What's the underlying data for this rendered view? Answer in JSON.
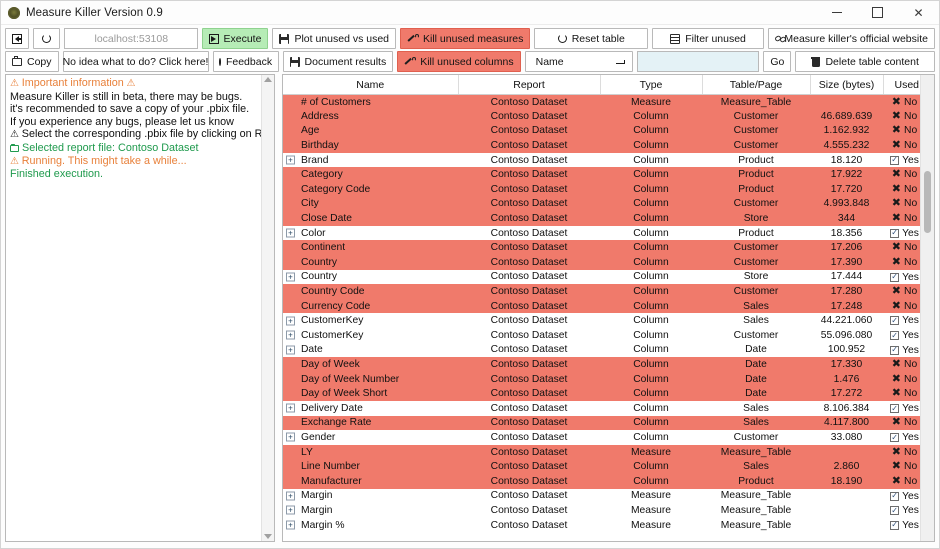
{
  "window": {
    "title": "Measure Killer Version 0.9",
    "app_icon": "app-logo-icon",
    "minimize": "–",
    "maximize": "□",
    "close": "✕"
  },
  "toolbar": {
    "row1": {
      "back_label": "",
      "refresh_label": "",
      "url_value": "localhost:53108",
      "execute_label": "Execute",
      "plot_label": "Plot unused vs used",
      "kill_measures_label": "Kill unused measures",
      "reset_table_label": "Reset table",
      "filter_unused_label": "Filter unused",
      "website_label": "Measure killer's official website"
    },
    "row2": {
      "copy_label": "Copy",
      "help_label": "No idea what to do? Click here!",
      "feedback_label": "Feedback",
      "document_label": "Document results",
      "kill_columns_label": "Kill unused columns",
      "name_dropdown_value": "Name",
      "search_value": "",
      "search_placeholder": "",
      "go_label": "Go",
      "delete_table_label": "Delete table content"
    }
  },
  "log_panel": {
    "lines": [
      {
        "text": "Important information",
        "color": "orange",
        "icon": "warning-icon",
        "icon_after": "warning-icon"
      },
      {
        "text": "Measure Killer is still in beta, there may be bugs.",
        "color": "black",
        "icon": ""
      },
      {
        "text": "it's recommended to save a copy of your .pbix file.",
        "color": "black",
        "icon": ""
      },
      {
        "text": "If you experience any bugs, please let us know",
        "color": "black",
        "icon": ""
      },
      {
        "text": "Select the corresponding .pbix file by clicking on Run",
        "color": "black",
        "icon": "warning-icon"
      },
      {
        "text": "Selected report file: Contoso Dataset",
        "color": "green",
        "icon": "folder-icon"
      },
      {
        "text": "Running. This might take a while...",
        "color": "orange",
        "icon": "warning-icon"
      },
      {
        "text": "Finished execution.",
        "color": "green",
        "icon": ""
      }
    ]
  },
  "table": {
    "columns": [
      "Name",
      "Report",
      "Type",
      "Table/Page",
      "Size (bytes)",
      "Used"
    ],
    "yes_label": "Yes",
    "no_label": "No",
    "rows": [
      {
        "name": "# of Customers",
        "report": "Contoso Dataset",
        "type": "Measure",
        "table": "Measure_Table",
        "size": "",
        "used": "No",
        "expandable": false
      },
      {
        "name": "Address",
        "report": "Contoso Dataset",
        "type": "Column",
        "table": "Customer",
        "size": "46.689.639",
        "used": "No",
        "expandable": false
      },
      {
        "name": "Age",
        "report": "Contoso Dataset",
        "type": "Column",
        "table": "Customer",
        "size": "1.162.932",
        "used": "No",
        "expandable": false
      },
      {
        "name": "Birthday",
        "report": "Contoso Dataset",
        "type": "Column",
        "table": "Customer",
        "size": "4.555.232",
        "used": "No",
        "expandable": false
      },
      {
        "name": "Brand",
        "report": "Contoso Dataset",
        "type": "Column",
        "table": "Product",
        "size": "18.120",
        "used": "Yes",
        "expandable": true
      },
      {
        "name": "Category",
        "report": "Contoso Dataset",
        "type": "Column",
        "table": "Product",
        "size": "17.922",
        "used": "No",
        "expandable": false
      },
      {
        "name": "Category Code",
        "report": "Contoso Dataset",
        "type": "Column",
        "table": "Product",
        "size": "17.720",
        "used": "No",
        "expandable": false
      },
      {
        "name": "City",
        "report": "Contoso Dataset",
        "type": "Column",
        "table": "Customer",
        "size": "4.993.848",
        "used": "No",
        "expandable": false
      },
      {
        "name": "Close Date",
        "report": "Contoso Dataset",
        "type": "Column",
        "table": "Store",
        "size": "344",
        "used": "No",
        "expandable": false
      },
      {
        "name": "Color",
        "report": "Contoso Dataset",
        "type": "Column",
        "table": "Product",
        "size": "18.356",
        "used": "Yes",
        "expandable": true
      },
      {
        "name": "Continent",
        "report": "Contoso Dataset",
        "type": "Column",
        "table": "Customer",
        "size": "17.206",
        "used": "No",
        "expandable": false
      },
      {
        "name": "Country",
        "report": "Contoso Dataset",
        "type": "Column",
        "table": "Customer",
        "size": "17.390",
        "used": "No",
        "expandable": false
      },
      {
        "name": "Country",
        "report": "Contoso Dataset",
        "type": "Column",
        "table": "Store",
        "size": "17.444",
        "used": "Yes",
        "expandable": true
      },
      {
        "name": "Country Code",
        "report": "Contoso Dataset",
        "type": "Column",
        "table": "Customer",
        "size": "17.280",
        "used": "No",
        "expandable": false
      },
      {
        "name": "Currency Code",
        "report": "Contoso Dataset",
        "type": "Column",
        "table": "Sales",
        "size": "17.248",
        "used": "No",
        "expandable": false
      },
      {
        "name": "CustomerKey",
        "report": "Contoso Dataset",
        "type": "Column",
        "table": "Sales",
        "size": "44.221.060",
        "used": "Yes",
        "expandable": true
      },
      {
        "name": "CustomerKey",
        "report": "Contoso Dataset",
        "type": "Column",
        "table": "Customer",
        "size": "55.096.080",
        "used": "Yes",
        "expandable": true
      },
      {
        "name": "Date",
        "report": "Contoso Dataset",
        "type": "Column",
        "table": "Date",
        "size": "100.952",
        "used": "Yes",
        "expandable": true
      },
      {
        "name": "Day of Week",
        "report": "Contoso Dataset",
        "type": "Column",
        "table": "Date",
        "size": "17.330",
        "used": "No",
        "expandable": false
      },
      {
        "name": "Day of Week Number",
        "report": "Contoso Dataset",
        "type": "Column",
        "table": "Date",
        "size": "1.476",
        "used": "No",
        "expandable": false
      },
      {
        "name": "Day of Week Short",
        "report": "Contoso Dataset",
        "type": "Column",
        "table": "Date",
        "size": "17.272",
        "used": "No",
        "expandable": false
      },
      {
        "name": "Delivery Date",
        "report": "Contoso Dataset",
        "type": "Column",
        "table": "Sales",
        "size": "8.106.384",
        "used": "Yes",
        "expandable": true
      },
      {
        "name": "Exchange Rate",
        "report": "Contoso Dataset",
        "type": "Column",
        "table": "Sales",
        "size": "4.117.800",
        "used": "No",
        "expandable": false
      },
      {
        "name": "Gender",
        "report": "Contoso Dataset",
        "type": "Column",
        "table": "Customer",
        "size": "33.080",
        "used": "Yes",
        "expandable": true
      },
      {
        "name": "LY",
        "report": "Contoso Dataset",
        "type": "Measure",
        "table": "Measure_Table",
        "size": "",
        "used": "No",
        "expandable": false
      },
      {
        "name": "Line Number",
        "report": "Contoso Dataset",
        "type": "Column",
        "table": "Sales",
        "size": "2.860",
        "used": "No",
        "expandable": false
      },
      {
        "name": "Manufacturer",
        "report": "Contoso Dataset",
        "type": "Column",
        "table": "Product",
        "size": "18.190",
        "used": "No",
        "expandable": false
      },
      {
        "name": "Margin",
        "report": "Contoso Dataset",
        "type": "Measure",
        "table": "Measure_Table",
        "size": "",
        "used": "Yes",
        "expandable": true
      },
      {
        "name": "Margin",
        "report": "Contoso Dataset",
        "type": "Measure",
        "table": "Measure_Table",
        "size": "",
        "used": "Yes",
        "expandable": true
      },
      {
        "name": "Margin %",
        "report": "Contoso Dataset",
        "type": "Measure",
        "table": "Measure_Table",
        "size": "",
        "used": "Yes",
        "expandable": true
      }
    ]
  },
  "colors": {
    "unused_row": "#f07a6b",
    "execute_green": "#b6ecb6",
    "search_field": "#e4f2f6",
    "warning_orange": "#e8803a",
    "success_green": "#1f9a4d"
  }
}
